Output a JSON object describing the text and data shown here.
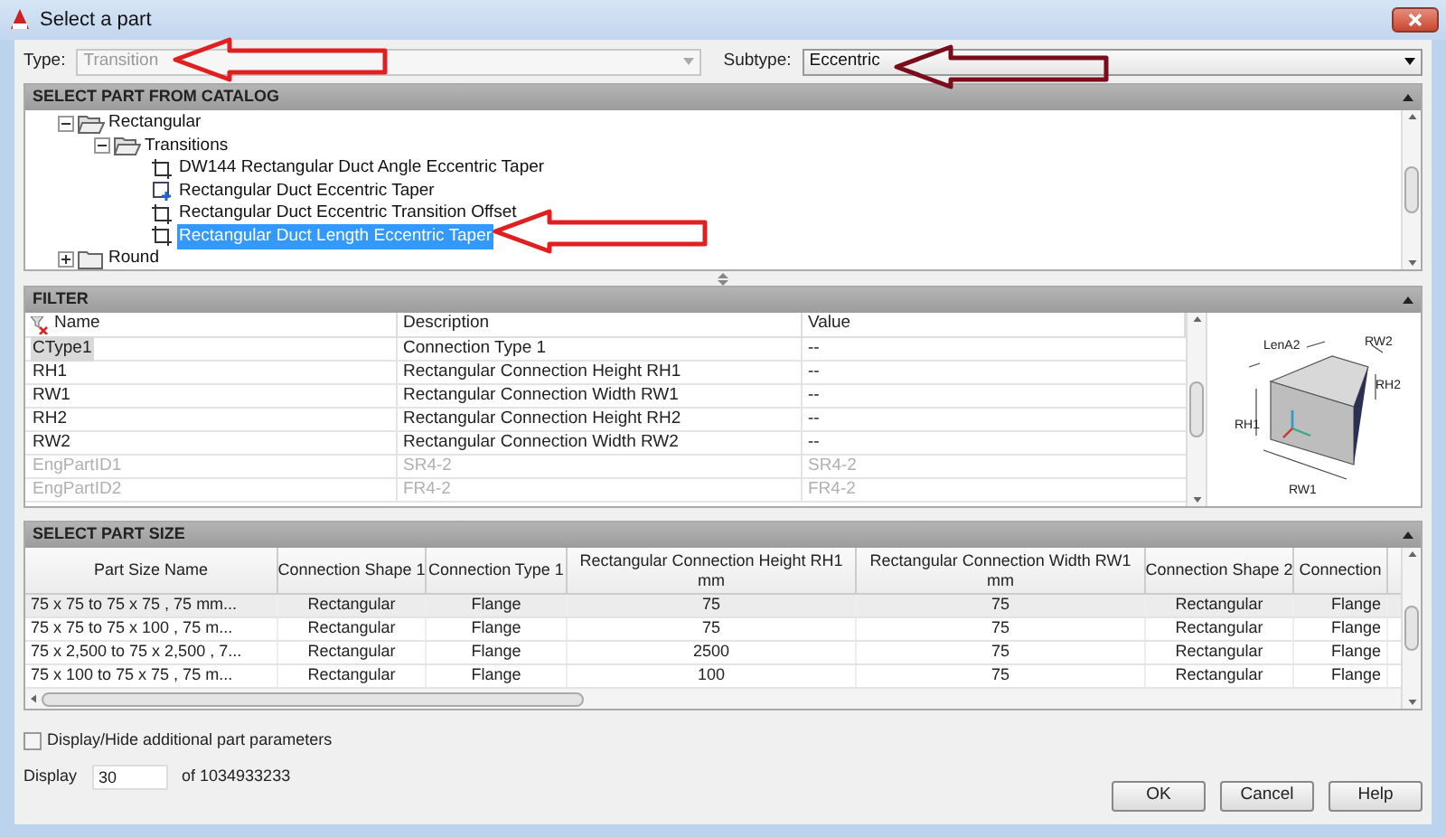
{
  "window": {
    "title": "Select a part"
  },
  "type_row": {
    "type_label": "Type:",
    "type_value": "Transition",
    "subtype_label": "Subtype:",
    "subtype_value": "Eccentric"
  },
  "catalog": {
    "title": "SELECT PART FROM CATALOG",
    "tree": [
      {
        "label": "Rectangular",
        "kind": "folder",
        "expanded": true,
        "children": [
          {
            "label": "Transitions",
            "kind": "folder",
            "expanded": true,
            "children": [
              {
                "label": "DW144 Rectangular Duct Angle Eccentric Taper",
                "kind": "part",
                "selected": false
              },
              {
                "label": "Rectangular Duct Eccentric Taper",
                "kind": "custom-part",
                "selected": false
              },
              {
                "label": "Rectangular Duct Eccentric Transition Offset",
                "kind": "part",
                "selected": false
              },
              {
                "label": "Rectangular Duct Length Eccentric Taper",
                "kind": "part",
                "selected": true
              }
            ]
          }
        ]
      },
      {
        "label": "Round",
        "kind": "folder",
        "expanded": false
      }
    ]
  },
  "filter": {
    "title": "FILTER",
    "columns": [
      "Name",
      "Description",
      "Value"
    ],
    "rows": [
      {
        "name": "CType1",
        "description": "Connection Type 1",
        "value": "--",
        "selected": true,
        "disabled": false
      },
      {
        "name": "RH1",
        "description": "Rectangular Connection Height RH1",
        "value": "--",
        "selected": false,
        "disabled": false
      },
      {
        "name": "RW1",
        "description": "Rectangular Connection Width RW1",
        "value": "--",
        "selected": false,
        "disabled": false
      },
      {
        "name": "RH2",
        "description": "Rectangular Connection Height RH2",
        "value": "--",
        "selected": false,
        "disabled": false
      },
      {
        "name": "RW2",
        "description": "Rectangular Connection Width RW2",
        "value": "--",
        "selected": false,
        "disabled": false
      },
      {
        "name": "EngPartID1",
        "description": "SR4-2",
        "value": "SR4-2",
        "selected": false,
        "disabled": true
      },
      {
        "name": "EngPartID2",
        "description": "FR4-2",
        "value": "FR4-2",
        "selected": false,
        "disabled": true
      }
    ],
    "diagram_labels": [
      "LenA2",
      "RW2",
      "RH2",
      "RH1",
      "RW1"
    ]
  },
  "part_size": {
    "title": "SELECT PART SIZE",
    "columns": [
      {
        "label": "Part Size Name"
      },
      {
        "label": "Connection Shape 1"
      },
      {
        "label": "Connection Type 1"
      },
      {
        "label": "Rectangular Connection Height RH1",
        "unit": "mm"
      },
      {
        "label": "Rectangular Connection Width RW1",
        "unit": "mm"
      },
      {
        "label": "Connection Shape 2"
      },
      {
        "label": "Connection"
      }
    ],
    "rows": [
      {
        "selected": true,
        "cells": [
          "75 x 75 to 75 x 75 , 75 mm...",
          "Rectangular",
          "Flange",
          "75",
          "75",
          "Rectangular",
          "Flange"
        ]
      },
      {
        "selected": false,
        "cells": [
          "75 x 75 to 75 x 100 , 75 m...",
          "Rectangular",
          "Flange",
          "75",
          "75",
          "Rectangular",
          "Flange"
        ]
      },
      {
        "selected": false,
        "cells": [
          "75 x 2,500 to 75 x 2,500 , 7...",
          "Rectangular",
          "Flange",
          "2500",
          "75",
          "Rectangular",
          "Flange"
        ]
      },
      {
        "selected": false,
        "cells": [
          "75 x 100 to 75 x 75 , 75 m...",
          "Rectangular",
          "Flange",
          "100",
          "75",
          "Rectangular",
          "Flange"
        ]
      }
    ]
  },
  "options": {
    "label": "Display/Hide additional part parameters",
    "checked": false
  },
  "display": {
    "label": "Display",
    "value": "30",
    "total": "of 1034933233"
  },
  "buttons": [
    "OK",
    "Cancel",
    "Help"
  ]
}
